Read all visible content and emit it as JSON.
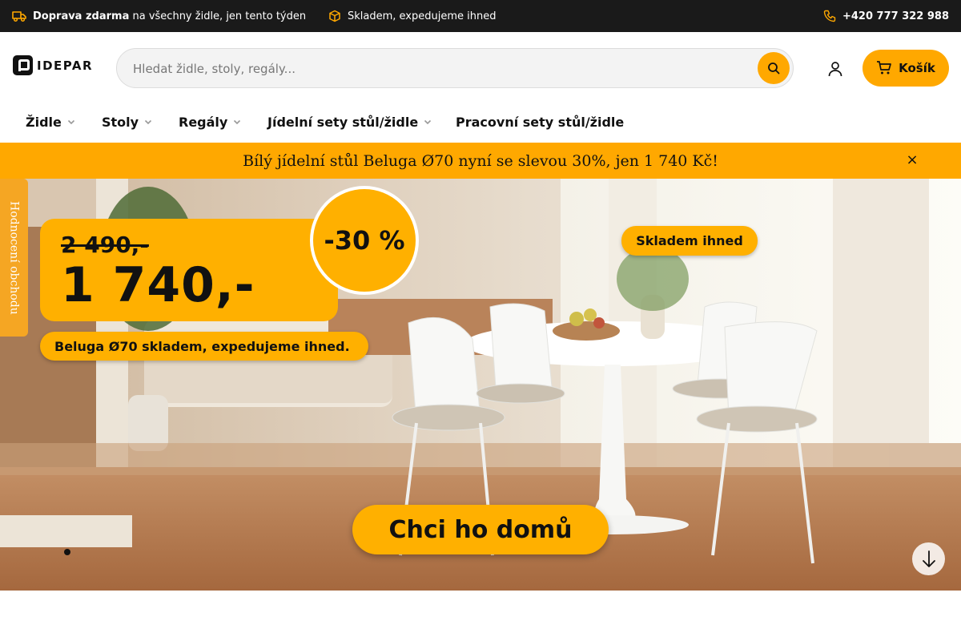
{
  "topbar": {
    "shipping_bold": "Doprava zdarma",
    "shipping_rest": "na všechny židle, jen tento týden",
    "stock": "Skladem, expedujeme ihned",
    "phone": "+420 777 322 988"
  },
  "header": {
    "logo_text": "IDEPAR",
    "search_placeholder": "Hledat židle, stoly, regály...",
    "cart_label": "Košík"
  },
  "nav": {
    "items": [
      {
        "label": "Židle",
        "has_dropdown": true
      },
      {
        "label": "Stoly",
        "has_dropdown": true
      },
      {
        "label": "Regály",
        "has_dropdown": true
      },
      {
        "label": "Jídelní sety stůl/židle",
        "has_dropdown": true
      },
      {
        "label": "Pracovní sety stůl/židle",
        "has_dropdown": false
      }
    ]
  },
  "promo": {
    "text": "Bílý jídelní stůl Beluga Ø70 nyní se slevou 30%, jen 1 740 Kč!",
    "close": "×"
  },
  "hero": {
    "old_price": "2 490,-",
    "new_price": "1 740,-",
    "discount": "-30 %",
    "stock_badge": "Skladem ihned",
    "stock_line": "Beluga Ø70 skladem, expedujeme ihned.",
    "cta": "Chci ho domů",
    "slides_count": 1,
    "active_slide": 1
  },
  "side_tab": {
    "label": "Hodnocení obchodu"
  },
  "colors": {
    "accent": "#ffa800",
    "topbar_bg": "#1a1a1a",
    "promo_bg": "#ffa800"
  },
  "icons": {
    "truck": "truck-icon",
    "box": "box-icon",
    "phone": "phone-icon",
    "search": "search-icon",
    "user": "user-icon",
    "cart": "cart-icon",
    "close": "close-icon",
    "arrow_down": "arrow-down-icon",
    "chevron": "chevron-down-icon"
  }
}
